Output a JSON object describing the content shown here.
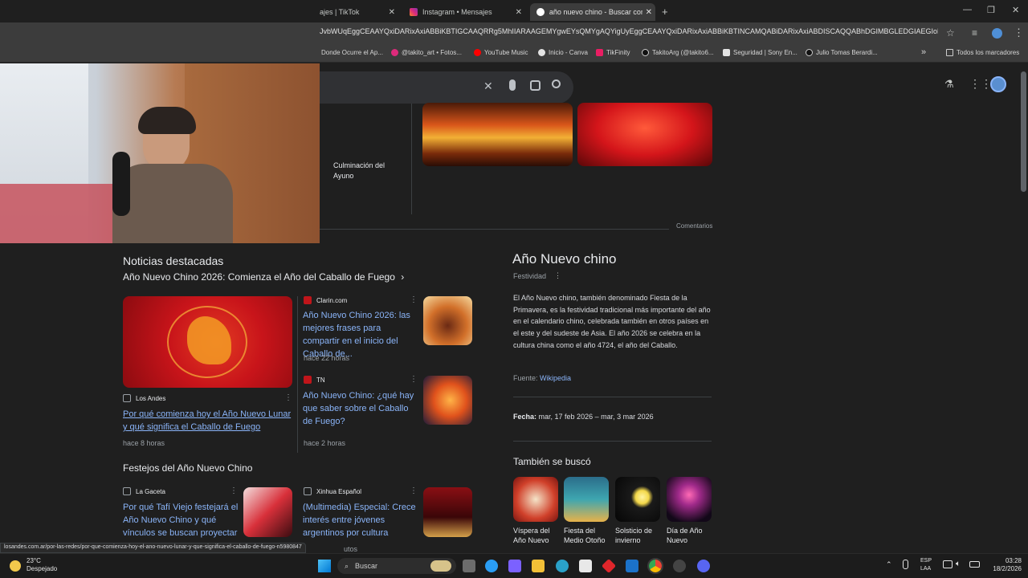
{
  "tabs": [
    {
      "label": "ajes | TikTok"
    },
    {
      "label": "Instagram • Mensajes"
    },
    {
      "label": "año nuevo chino - Buscar con G"
    }
  ],
  "address": {
    "url": "JvbWUqEggCEAAYQxiDARixAxiABBiKBTIGCAAQRRg5MhIIARAAGEMYgwEYsQMYgAQYigUyEggCEAAYQxiDARixAxiABBiKBTINCAMQABiDARixAxiABDISCAQQABhDGIMBGLEDGIAEGIoFMgY..."
  },
  "bookmarks": [
    {
      "label": "Donde Ocurre el Ap..."
    },
    {
      "label": "@takito_art • Fotos..."
    },
    {
      "label": "YouTube Music"
    },
    {
      "label": "Inicio - Canva"
    },
    {
      "label": "TikFinity"
    },
    {
      "label": "TakitoArg (@takito6..."
    },
    {
      "label": "Seguridad | Sony En..."
    },
    {
      "label": "Julio Tomas Berardi..."
    },
    {
      "label": "Todos los marcadores"
    }
  ],
  "top_partial": {
    "culm": "Culminación del Ayuno",
    "comentarios": "Comentarios"
  },
  "news": {
    "heading": "Noticias destacadas",
    "subheading": "Año Nuevo Chino 2026: Comienza el Año del Caballo de Fuego",
    "main": {
      "source": "Los Andes",
      "title": "Por qué comienza hoy el Año Nuevo Lunar y qué significa el Caballo de Fuego",
      "time": "hace 8 horas"
    },
    "items": [
      {
        "source": "Clarin.com",
        "title": "Año Nuevo Chino 2026: las mejores frases para compartir en el inicio del Caballo de...",
        "time": "hace 22 horas"
      },
      {
        "source": "TN",
        "title": "Año Nuevo Chino: ¿qué hay que saber sobre el Caballo de Fuego?",
        "time": "hace 2 horas"
      }
    ]
  },
  "festejos": {
    "heading": "Festejos del Año Nuevo Chino",
    "items": [
      {
        "source": "La Gaceta",
        "title": "Por qué Tafí Viejo festejará el Año Nuevo Chino y qué vínculos se buscan proyectar"
      },
      {
        "source": "Xinhua Español",
        "title": "(Multimedia) Especial: Crece interés entre jóvenes argentinos por cultura china..."
      }
    ]
  },
  "knowledge": {
    "title": "Año Nuevo chino",
    "type": "Festividad",
    "description": "El Año Nuevo chino, también denominado Fiesta de la Primavera, es la festividad tradicional más importante del año en el calendario chino, celebrada también en otros países en el este y del sudeste de Asia. El año 2026 se celebra en la cultura china como el año 4724, el año del Caballo.",
    "source_label": "Fuente:",
    "source_link": "Wikipedia",
    "date_label": "Fecha:",
    "date_value": "mar, 17 feb 2026 – mar, 3 mar 2026",
    "also_heading": "También se buscó",
    "also": [
      {
        "label": "Víspera del Año Nuevo chino"
      },
      {
        "label": "Fiesta del Medio Otoño"
      },
      {
        "label": "Solsticio de invierno"
      },
      {
        "label": "Día de Año Nuevo"
      }
    ]
  },
  "status_url": "losandes.com.ar/por-las-redes/por-que-comienza-hoy-el-ano-nuevo-lunar-y-que-significa-el-caballo-de-fuego-n5980847",
  "status_tail": "utos",
  "taskbar": {
    "temp": "23°C",
    "weather": "Despejado",
    "search": "Buscar",
    "lang1": "ESP",
    "lang2": "LAA",
    "time": "03:28",
    "date": "18/2/2026"
  },
  "colors": {
    "link": "#8ab4f8",
    "bg": "#1f1f1f",
    "accent_red": "#c0151a"
  }
}
